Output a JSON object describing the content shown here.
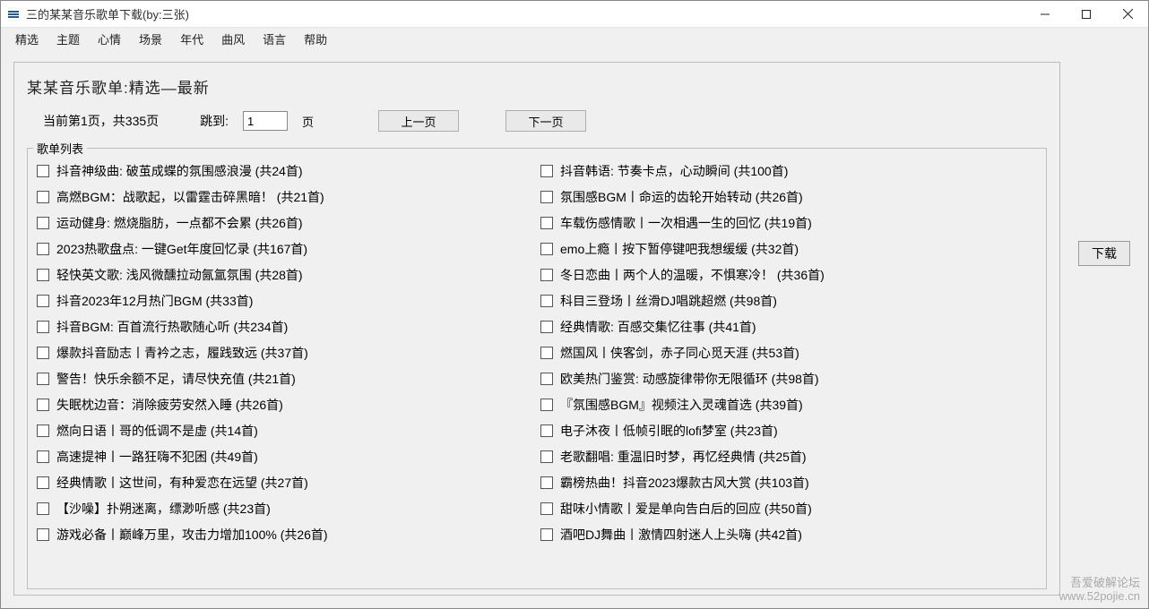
{
  "title": "三的某某音乐歌单下载(by:三张)",
  "menu": [
    "精选",
    "主题",
    "心情",
    "场景",
    "年代",
    "曲风",
    "语言",
    "帮助"
  ],
  "headline": "某某音乐歌单:精选—最新",
  "page_status": "当前第1页，共335页",
  "jump_label": "跳到:",
  "page_input": "1",
  "page_suffix": "页",
  "prev_btn": "上一页",
  "next_btn": "下一页",
  "group_title": "歌单列表",
  "download_btn": "下载",
  "watermark_top": "吾爱破解论坛",
  "watermark_bottom": "www.52pojie.cn",
  "left_items": [
    "抖音神级曲: 破茧成蝶的氛围感浪漫   (共24首)",
    "高燃BGM：战歌起，以雷霆击碎黑暗！   (共21首)",
    "运动健身: 燃烧脂肪，一点都不会累   (共26首)",
    "2023热歌盘点: 一键Get年度回忆录   (共167首)",
    "轻快英文歌: 浅风微醺拉动氤氲氛围   (共28首)",
    "抖音2023年12月热门BGM   (共33首)",
    "抖音BGM: 百首流行热歌随心听   (共234首)",
    "爆款抖音励志丨青衿之志，履践致远   (共37首)",
    "警告！快乐余额不足，请尽快充值   (共21首)",
    "失眠枕边音：消除疲劳安然入睡   (共26首)",
    "燃向日语丨哥的低调不是虚   (共14首)",
    "高速提神丨一路狂嗨不犯困   (共49首)",
    "经典情歌丨这世间，有种爱恋在远望   (共27首)",
    "【沙噪】扑朔迷离，缥渺听感   (共23首)",
    "游戏必备丨巅峰万里，攻击力增加100%   (共26首)"
  ],
  "right_items": [
    "抖音韩语: 节奏卡点，心动瞬间   (共100首)",
    "氛围感BGM丨命运的齿轮开始转动   (共26首)",
    "车载伤感情歌丨一次相遇一生的回忆   (共19首)",
    "emo上瘾丨按下暂停键吧我想缓缓   (共32首)",
    "冬日恋曲丨两个人的温暖，不惧寒冷！   (共36首)",
    "科目三登场丨丝滑DJ唱跳超燃   (共98首)",
    "经典情歌: 百感交集忆往事   (共41首)",
    "燃国风丨侠客剑，赤子同心觅天涯   (共53首)",
    "欧美热门鉴赏: 动感旋律带你无限循环   (共98首)",
    "『氛围感BGM』视频注入灵魂首选   (共39首)",
    "电子沐夜丨低帧引眠的lofi梦室   (共23首)",
    "老歌翻唱: 重温旧时梦，再忆经典情   (共25首)",
    "霸榜热曲！抖音2023爆款古风大赏   (共103首)",
    "甜味小情歌丨爱是单向告白后的回应   (共50首)",
    "酒吧DJ舞曲丨激情四射迷人上头嗨   (共42首)"
  ]
}
